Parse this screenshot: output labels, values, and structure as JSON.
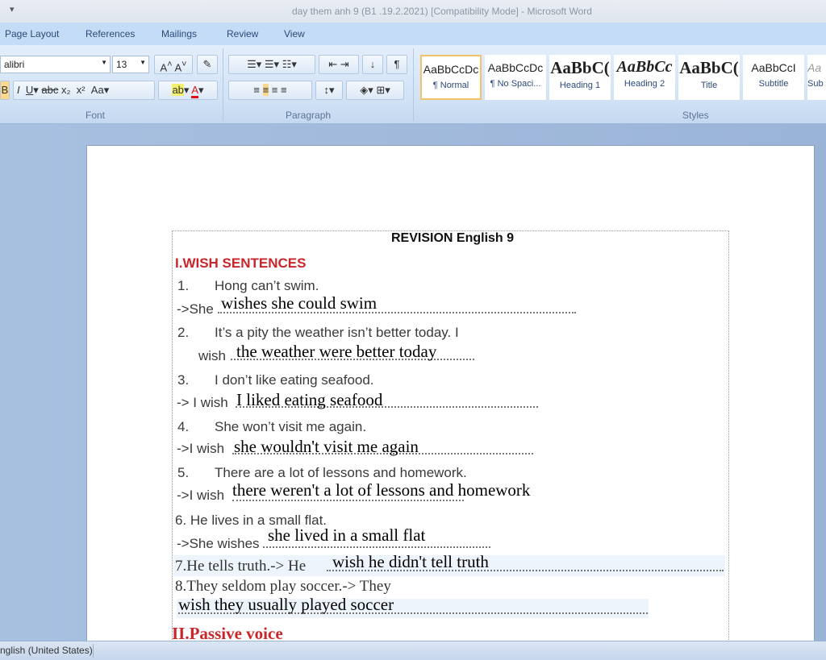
{
  "window": {
    "title": "day them anh 9 (B1 .19.2.2021) [Compatibility Mode] - Microsoft Word"
  },
  "tabs": [
    "Page Layout",
    "References",
    "Mailings",
    "Review",
    "View"
  ],
  "ribbon": {
    "font": {
      "name": "alibri",
      "size": "13",
      "label": "Font"
    },
    "paragraph": {
      "label": "Paragraph"
    },
    "styles": {
      "label": "Styles",
      "items": [
        {
          "sample": "AaBbCcDc",
          "name": "¶ Normal"
        },
        {
          "sample": "AaBbCcDc",
          "name": "¶ No Spaci..."
        },
        {
          "sample": "AaBbC(",
          "name": "Heading 1"
        },
        {
          "sample": "AaBbCc",
          "name": "Heading 2"
        },
        {
          "sample": "AaBbC(",
          "name": "Title"
        },
        {
          "sample": "AaBbCcI",
          "name": "Subtitle"
        },
        {
          "sample": "Aa",
          "name": "Sub"
        }
      ]
    }
  },
  "doc": {
    "title": "REVISION English 9",
    "section1": "I.WISH SENTENCES",
    "q1": {
      "num": "1.",
      "text": "Hong can’t swim.",
      "prefix": "->She",
      "answer": "wishes she could swim"
    },
    "q2": {
      "num": "2.",
      "text": "It’s a pity the weather isn’t better today. I",
      "prefix": "wish",
      "answer": "the weather were better today"
    },
    "q3": {
      "num": "3.",
      "text": "I don’t like eating seafood.",
      "prefix": "-> I wish",
      "answer": "I liked eating seafood"
    },
    "q4": {
      "num": "4.",
      "text": "She won’t visit me again.",
      "prefix": "->I wish",
      "answer": "she wouldn't visit me again"
    },
    "q5": {
      "num": "5.",
      "text": "There are a lot of lessons and homework.",
      "prefix": "->I wish",
      "answer": "there weren't a lot of lessons and homework"
    },
    "q6": {
      "text": "6. He lives in a small flat.",
      "prefix": "->She wishes",
      "answer": "she lived in a small flat"
    },
    "q7": {
      "text": "7.He  tells truth.-> He",
      "answer": "wish he didn't tell truth"
    },
    "q8": {
      "text": "8.They seldom play soccer.-> They",
      "answer": "wish they usually played soccer"
    },
    "section2": "II.Passive voice"
  },
  "status": {
    "language": "nglish (United States)"
  }
}
